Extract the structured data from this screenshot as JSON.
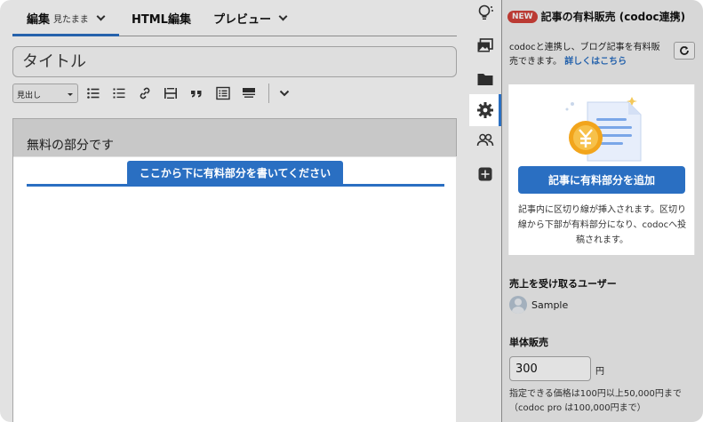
{
  "tabs": {
    "edit_label": "編集",
    "edit_sub": "見たまま",
    "html_label": "HTML編集",
    "preview_label": "プレビュー"
  },
  "title_placeholder": "タイトル",
  "toolbar": {
    "heading_select": "見出し",
    "icons": [
      "bullet-list-icon",
      "numbered-list-icon",
      "link-icon",
      "more-tag-icon",
      "quote-icon",
      "table-of-contents-icon",
      "paid-divider-icon",
      "chevron-down-icon"
    ]
  },
  "content": {
    "free_text": "無料の部分です",
    "divider_label": "ここから下に有料部分を書いてください"
  },
  "sidebar": {
    "new_badge": "NEW",
    "title": "記事の有料販売 (codoc連携)",
    "description": "codocと連携し、ブログ記事を有料販売できます。",
    "details_link": "詳しくはこちら",
    "add_button": "記事に有料部分を追加",
    "note": "記事内に区切り線が挿入されます。区切り線から下部が有料部分になり、codocへ投稿されます。",
    "seller_label": "売上を受け取るユーザー",
    "seller_name": "Sample",
    "single_sale_label": "単体販売",
    "price_value": "300",
    "price_unit": "円",
    "price_note": "指定できる価格は100円以上50,000円まで（codoc pro は100,000円まで）"
  },
  "colors": {
    "accent": "#2a6fc2",
    "badge": "#d4423a",
    "coin": "#f2a51c"
  }
}
